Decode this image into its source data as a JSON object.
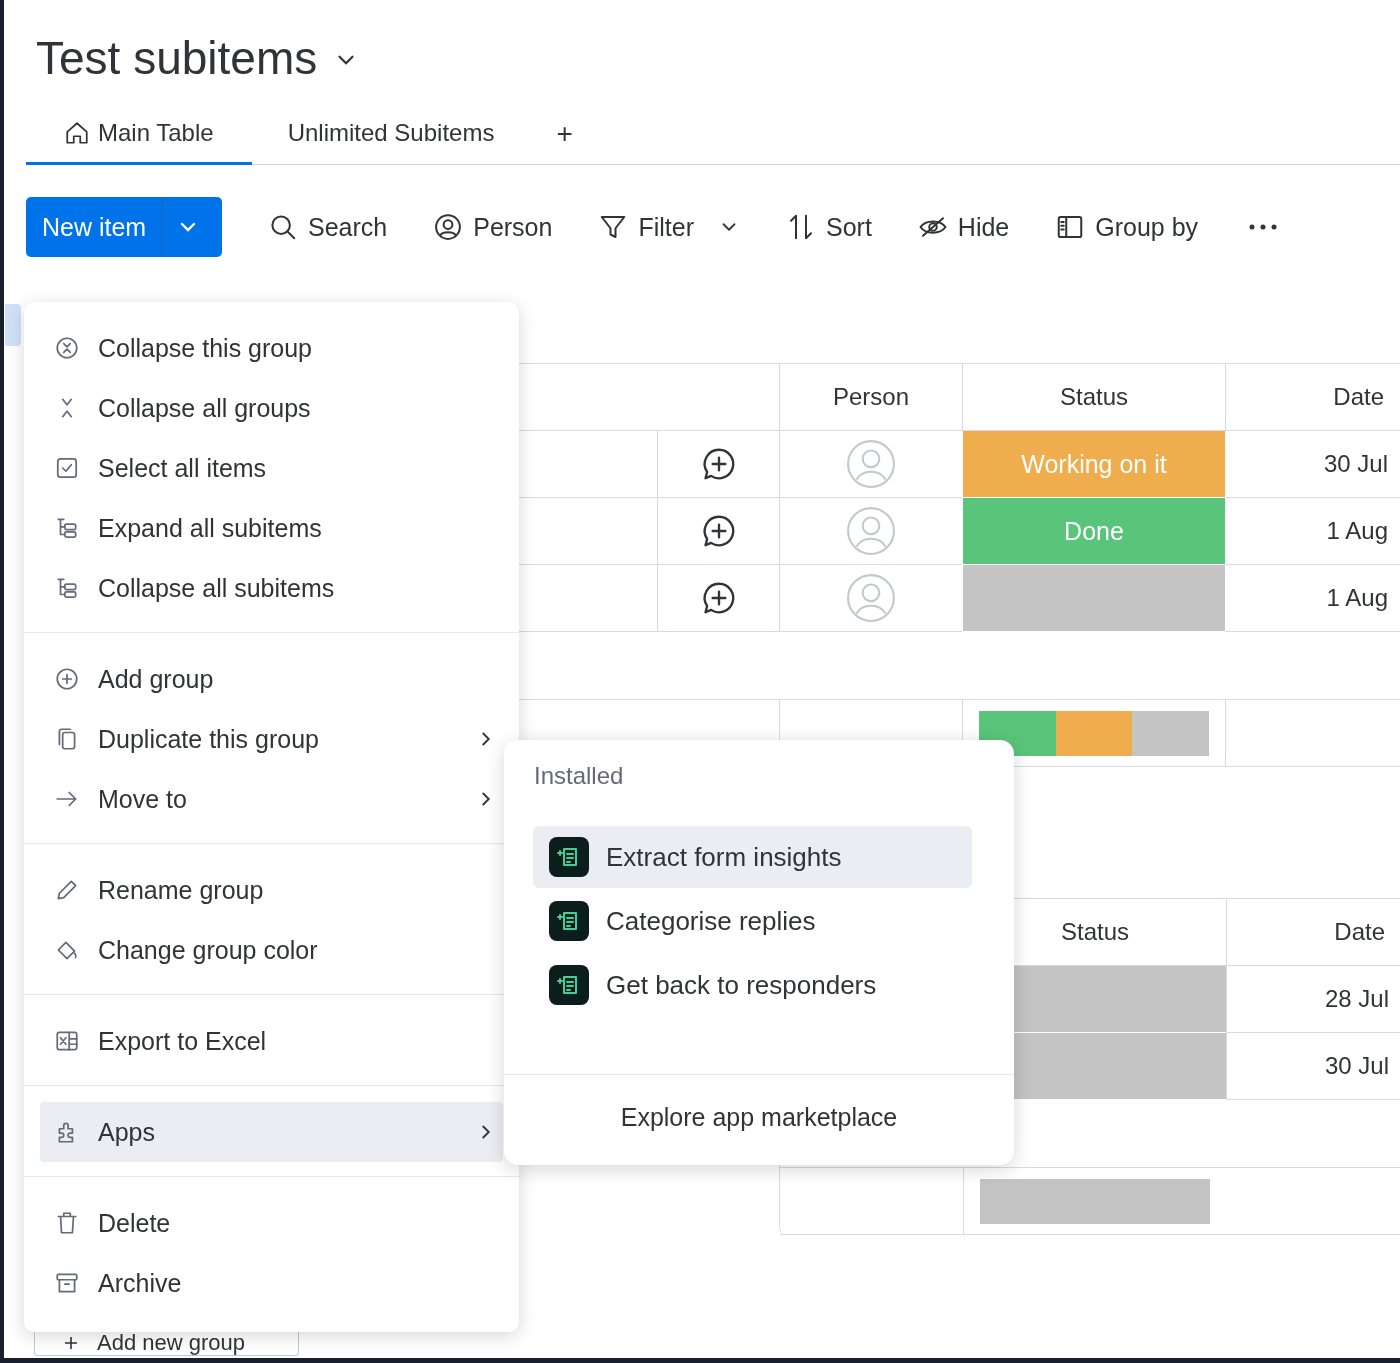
{
  "board": {
    "title": "Test subitems"
  },
  "tabs": [
    {
      "label": "Main Table",
      "selected": true,
      "kind": "home"
    },
    {
      "label": "Unlimited Subitems",
      "selected": false,
      "kind": "plain"
    }
  ],
  "add_tab": "+",
  "toolbar": {
    "new_item": "New item",
    "tools": [
      {
        "label": "Search",
        "kind": "search"
      },
      {
        "label": "Person",
        "kind": "person"
      },
      {
        "label": "Filter",
        "kind": "filter"
      },
      {
        "label": "Sort",
        "kind": "sort"
      },
      {
        "label": "Hide",
        "kind": "hide"
      },
      {
        "label": "Group by",
        "kind": "groupby"
      }
    ]
  },
  "groups": [
    {
      "columns": [
        "Person",
        "Status",
        "Date"
      ],
      "rows": [
        {
          "status": {
            "label": "Working on it",
            "color": "#f0ad4e"
          },
          "date": "30 Jul"
        },
        {
          "status": {
            "label": "Done",
            "color": "#59c57a"
          },
          "date": "1 Aug"
        },
        {
          "status": {
            "color": "#c4c4c4"
          },
          "date": "1 Aug"
        }
      ],
      "summary": [
        {
          "color": "#59c57a"
        },
        {
          "color": "#f0ad4e"
        },
        {
          "color": "#c4c4c4"
        }
      ]
    },
    {
      "columns": [
        "Status",
        "Date"
      ],
      "rows": [
        {
          "status": {
            "color": "#c4c4c4"
          },
          "date": "28 Jul"
        },
        {
          "status": {
            "color": "#c4c4c4"
          },
          "date": "30 Jul"
        }
      ],
      "summary": [
        {
          "color": "#c4c4c4"
        }
      ]
    }
  ],
  "add_group_button": "Add new group",
  "group_menu": {
    "sections": [
      [
        {
          "label": "Collapse this group",
          "kind": "collapse-one",
          "selected": false,
          "submenu": false
        },
        {
          "label": "Collapse all groups",
          "kind": "collapse-all",
          "selected": false,
          "submenu": false
        },
        {
          "label": "Select all items",
          "kind": "select",
          "selected": false,
          "submenu": false
        },
        {
          "label": "Expand all subitems",
          "kind": "subitems",
          "selected": false,
          "submenu": false
        },
        {
          "label": "Collapse all subitems",
          "kind": "subitems",
          "selected": false,
          "submenu": false
        }
      ],
      [
        {
          "label": "Add group",
          "kind": "add",
          "selected": false,
          "submenu": false
        },
        {
          "label": "Duplicate this group",
          "kind": "duplicate",
          "selected": false,
          "submenu": true
        },
        {
          "label": "Move to",
          "kind": "move",
          "selected": false,
          "submenu": true
        }
      ],
      [
        {
          "label": "Rename group",
          "kind": "rename",
          "selected": false,
          "submenu": false
        },
        {
          "label": "Change group color",
          "kind": "color",
          "selected": false,
          "submenu": false
        }
      ],
      [
        {
          "label": "Export to Excel",
          "kind": "excel",
          "selected": false,
          "submenu": false
        }
      ],
      [
        {
          "label": "Apps",
          "kind": "apps",
          "selected": true,
          "submenu": true
        }
      ],
      [
        {
          "label": "Delete",
          "kind": "delete",
          "selected": false,
          "submenu": false
        },
        {
          "label": "Archive",
          "kind": "archive",
          "selected": false,
          "submenu": false
        }
      ]
    ]
  },
  "apps_menu": {
    "heading": "Installed",
    "items": [
      {
        "label": "Extract form insights",
        "selected": true
      },
      {
        "label": "Categorise replies",
        "selected": false
      },
      {
        "label": "Get back to responders",
        "selected": false
      }
    ],
    "footer": "Explore app marketplace"
  }
}
